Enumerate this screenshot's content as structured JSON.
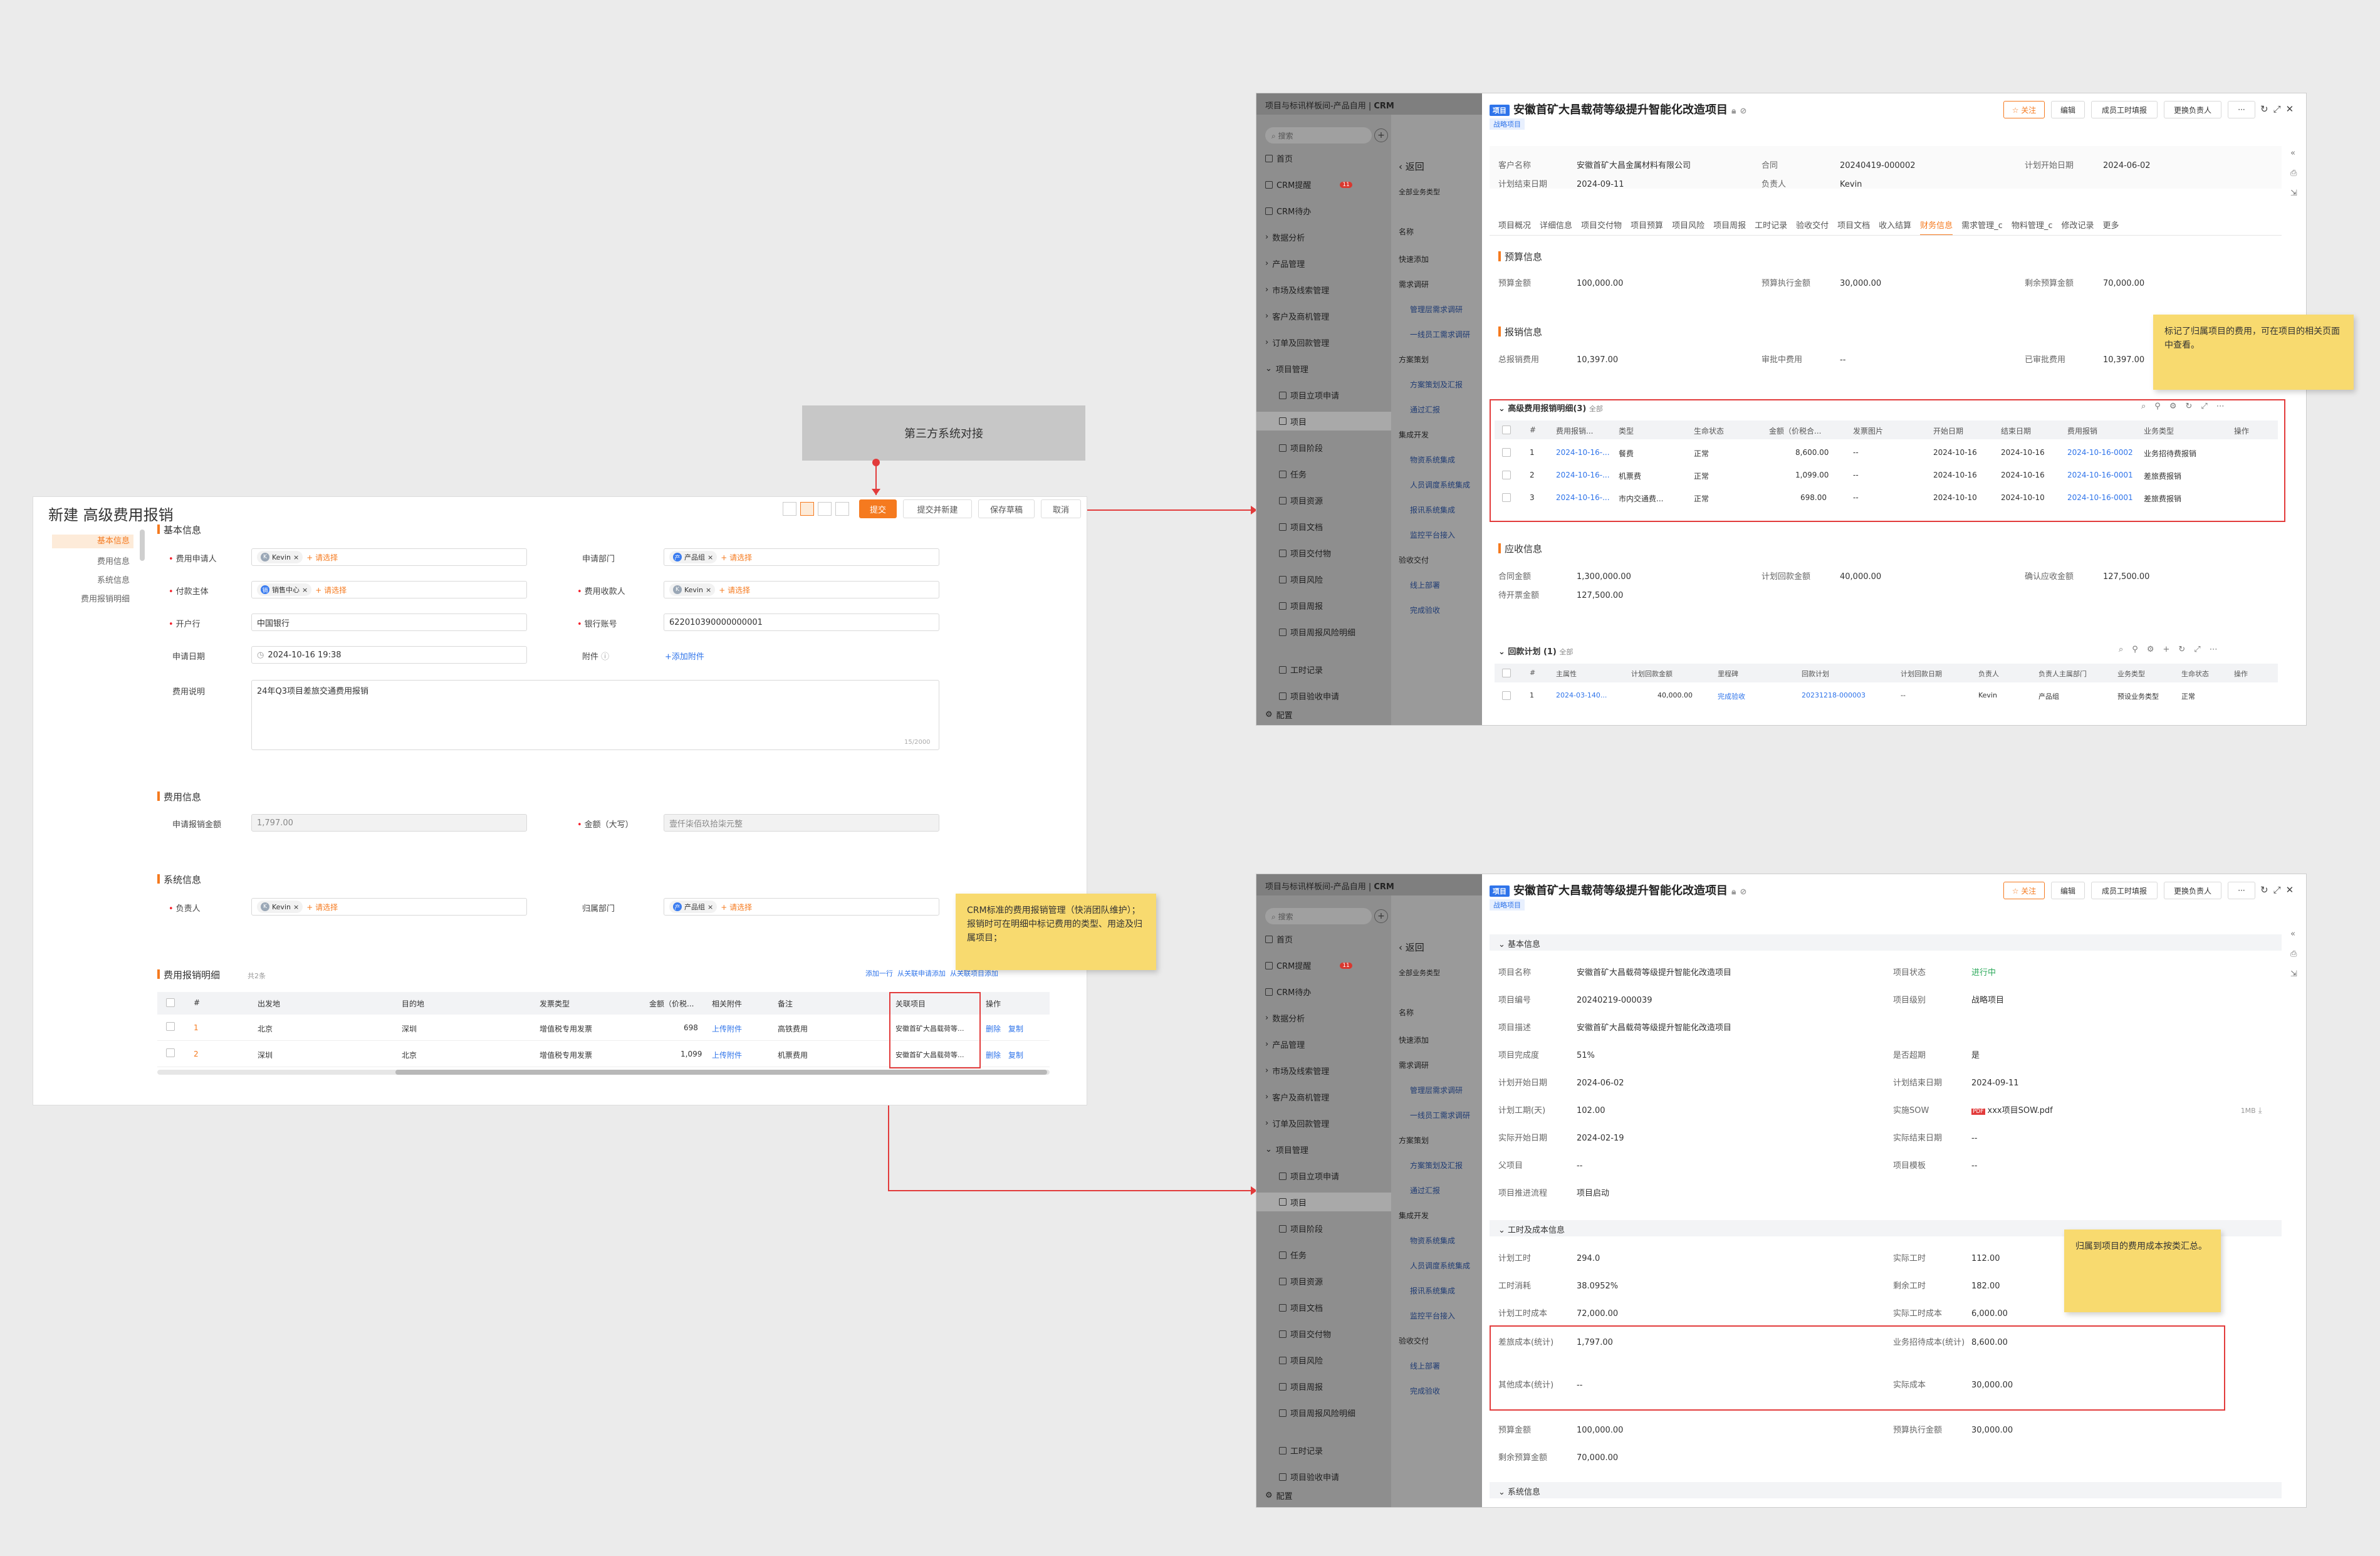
{
  "third_party_box": "第三方系统对接",
  "notes": {
    "crm_note": "CRM标准的费用报销管理（快消团队维护）；\n报销时可在明细中标记费用的类型、用途及归属项目；",
    "finance_note": "标记了归属项目的费用，可在项目的相关页面中查看。",
    "cost_note": "归属到项目的费用成本按类汇总。"
  },
  "form": {
    "title": "新建 高级费用报销",
    "buttons": {
      "submit": "提交",
      "submit_new": "提交并新建",
      "save_draft": "保存草稿",
      "cancel": "取消"
    },
    "left_nav": [
      "基本信息",
      "费用信息",
      "系统信息",
      "费用报销明细"
    ],
    "basic_section": "基本信息",
    "fields": {
      "applicant_label": "费用申请人",
      "applicant_tag": "Kevin",
      "select_placeholder": "+ 请选择",
      "dept_label": "申请部门",
      "dept_tag": "产品组",
      "payer_label": "付款主体",
      "payer_tag": "销售中心",
      "payee_label": "费用收款人",
      "payee_tag": "Kevin",
      "bank_label": "开户行",
      "bank_value": "中国银行",
      "account_label": "银行账号",
      "account_value": "622010390000000001",
      "date_label": "申请日期",
      "date_value": "2024-10-16 19:38",
      "attach_label": "附件",
      "attach_add": "+添加附件",
      "desc_label": "费用说明",
      "desc_value": "24年Q3项目差旅交通费用报销",
      "desc_count": "15/2000"
    },
    "expense_section": "费用信息",
    "expense": {
      "amount_label": "申请报销金额",
      "amount_value": "1,797.00",
      "upper_label": "金额（大写）",
      "upper_value": "壹仟柒佰玖拾柒元整"
    },
    "system_section": "系统信息",
    "system": {
      "owner_label": "负责人",
      "owner_tag": "Kevin",
      "dept_label": "归属部门",
      "dept_tag": "产品组"
    },
    "detail_section": "费用报销明细",
    "detail_count": "共2条",
    "detail_actions": [
      "添加一行",
      "从关联申请添加",
      "从关联项目添加"
    ],
    "detail_headers": [
      "#",
      "出发地",
      "目的地",
      "发票类型",
      "金额（价税...",
      "相关附件",
      "备注",
      "关联项目",
      "操作"
    ],
    "detail_rows": [
      {
        "n": "1",
        "from": "北京",
        "to": "深圳",
        "invoice": "增值税专用发票",
        "amount": "698",
        "attach": "上传附件",
        "remark": "高铁费用",
        "project": "安徽首矿大昌载荷等...",
        "ops": [
          "删除",
          "复制"
        ]
      },
      {
        "n": "2",
        "from": "深圳",
        "to": "北京",
        "invoice": "增值税专用发票",
        "amount": "1,099",
        "attach": "上传附件",
        "remark": "机票费用",
        "project": "安徽首矿大昌载荷等...",
        "ops": [
          "删除",
          "复制"
        ]
      }
    ]
  },
  "crm": {
    "breadcrumb": "项目与标讯样板间-产品自用",
    "app": "CRM",
    "search_placeholder": "搜索",
    "menu": [
      {
        "label": "首页",
        "level": 0
      },
      {
        "label": "CRM提醒",
        "level": 0,
        "badge": "11"
      },
      {
        "label": "CRM待办",
        "level": 0
      },
      {
        "label": "数据分析",
        "level": 0
      },
      {
        "label": "产品管理",
        "level": 0
      },
      {
        "label": "市场及线索管理",
        "level": 0
      },
      {
        "label": "客户及商机管理",
        "level": 0
      },
      {
        "label": "订单及回款管理",
        "level": 0
      },
      {
        "label": "项目管理",
        "level": 0
      },
      {
        "label": "项目立项申请",
        "level": 1
      },
      {
        "label": "项目",
        "level": 1,
        "active": true
      },
      {
        "label": "项目阶段",
        "level": 1
      },
      {
        "label": "任务",
        "level": 1
      },
      {
        "label": "项目资源",
        "level": 1
      },
      {
        "label": "项目文档",
        "level": 1
      },
      {
        "label": "项目交付物",
        "level": 1
      },
      {
        "label": "项目风险",
        "level": 1
      },
      {
        "label": "项目周报",
        "level": 1
      },
      {
        "label": "项目周报风险明细",
        "level": 1
      },
      {
        "label": "工时记录",
        "level": 1
      },
      {
        "label": "项目验收申请",
        "level": 1
      }
    ],
    "config": "配置",
    "list": {
      "back": "返回",
      "filter": "全部业务类型",
      "col": "名称",
      "items": [
        {
          "label": "快速添加",
          "h": true
        },
        {
          "label": "需求调研",
          "h": true
        },
        {
          "label": "管理层需求调研"
        },
        {
          "label": "一线员工需求调研"
        },
        {
          "label": "方案策划",
          "h": true
        },
        {
          "label": "方案策划及汇报"
        },
        {
          "label": "通过汇报"
        },
        {
          "label": "集成开发",
          "h": true
        },
        {
          "label": "物资系统集成"
        },
        {
          "label": "人员调度系统集成"
        },
        {
          "label": "报讯系统集成"
        },
        {
          "label": "监控平台接入"
        },
        {
          "label": "验收交付",
          "h": true
        },
        {
          "label": "线上部署"
        },
        {
          "label": "完成验收"
        }
      ]
    },
    "project_tag": "项目",
    "project_title": "安徽首矿大昌载荷等级提升智能化改造项目",
    "strategic": "战略项目",
    "header_buttons": {
      "follow": "☆ 关注",
      "edit": "编辑",
      "fill_hours": "成员工时填报",
      "change_owner": "更换负责人",
      "more": "···"
    }
  },
  "finance_view": {
    "summary": [
      {
        "k": "客户名称",
        "v": "安徽首矿大昌金属材料有限公司",
        "link": true
      },
      {
        "k": "合同",
        "v": "20240419-000002",
        "link": true
      },
      {
        "k": "计划开始日期",
        "v": "2024-06-02"
      },
      {
        "k": "计划结束日期",
        "v": "2024-09-11"
      },
      {
        "k": "负责人",
        "v": "Kevin"
      }
    ],
    "tabs": [
      "项目概况",
      "详细信息",
      "项目交付物",
      "项目预算",
      "项目风险",
      "项目周报",
      "工时记录",
      "验收交付",
      "项目文档",
      "收入结算",
      "财务信息",
      "需求管理_c",
      "物料管理_c",
      "修改记录",
      "更多"
    ],
    "active_tab": "财务信息",
    "budget_section": "预算信息",
    "budget": [
      {
        "k": "预算金额",
        "v": "100,000.00"
      },
      {
        "k": "预算执行金额",
        "v": "30,000.00"
      },
      {
        "k": "剩余预算金额",
        "v": "70,000.00"
      }
    ],
    "reimburse_section": "报销信息",
    "reimburse": [
      {
        "k": "总报销费用",
        "v": "10,397.00"
      },
      {
        "k": "审批中费用",
        "v": "--"
      },
      {
        "k": "已审批费用",
        "v": "10,397.00"
      }
    ],
    "exp_table_title": "高级费用报销明细(3)",
    "exp_table_filter": "全部",
    "exp_headers": [
      "#",
      "费用报销...",
      "类型",
      "生命状态",
      "金额（价税合...",
      "发票图片",
      "开始日期",
      "结束日期",
      "费用报销",
      "业务类型",
      "操作"
    ],
    "exp_rows": [
      {
        "n": "1",
        "code": "2024-10-16-...",
        "type": "餐费",
        "status": "正常",
        "amount": "8,600.00",
        "img": "--",
        "start": "2024-10-16",
        "end": "2024-10-16",
        "reim": "2024-10-16-0002",
        "biz": "业务招待费报销"
      },
      {
        "n": "2",
        "code": "2024-10-16-...",
        "type": "机票费",
        "status": "正常",
        "amount": "1,099.00",
        "img": "--",
        "start": "2024-10-16",
        "end": "2024-10-16",
        "reim": "2024-10-16-0001",
        "biz": "差旅费报销"
      },
      {
        "n": "3",
        "code": "2024-10-16-...",
        "type": "市内交通费...",
        "status": "正常",
        "amount": "698.00",
        "img": "--",
        "start": "2024-10-10",
        "end": "2024-10-10",
        "reim": "2024-10-16-0001",
        "biz": "差旅费报销"
      }
    ],
    "receivable_section": "应收信息",
    "receivable": [
      {
        "k": "合同金额",
        "v": "1,300,000.00"
      },
      {
        "k": "计划回款金额",
        "v": "40,000.00"
      },
      {
        "k": "确认应收金额",
        "v": "127,500.00"
      },
      {
        "k": "待开票金额",
        "v": "127,500.00"
      }
    ],
    "plan_table_title": "回款计划 (1)",
    "plan_filter": "全部",
    "plan_headers": [
      "#",
      "主属性",
      "计划回款金额",
      "里程碑",
      "回款计划",
      "计划回款日期",
      "负责人",
      "负责人主属部门",
      "业务类型",
      "生命状态",
      "操作"
    ],
    "plan_rows": [
      {
        "n": "1",
        "attr": "2024-03-140...",
        "amount": "40,000.00",
        "milestone": "完成验收",
        "plan": "20231218-000003",
        "date": "--",
        "owner": "Kevin",
        "dept": "产品组",
        "biz": "预设业务类型",
        "status": "正常"
      }
    ]
  },
  "detail_view": {
    "basic_section": "基本信息",
    "basic": [
      {
        "k": "项目名称",
        "v": "安徽首矿大昌载荷等级提升智能化改造项目"
      },
      {
        "k": "项目状态",
        "v": "进行中",
        "green": true
      },
      {
        "k": "项目编号",
        "v": "20240219-000039"
      },
      {
        "k": "项目级别",
        "v": "战略项目"
      },
      {
        "k": "项目描述",
        "v": "安徽首矿大昌载荷等级提升智能化改造项目"
      },
      {
        "k": "项目完成度",
        "v": "51%"
      },
      {
        "k": "是否超期",
        "v": "是"
      },
      {
        "k": "计划开始日期",
        "v": "2024-06-02"
      },
      {
        "k": "计划结束日期",
        "v": "2024-09-11"
      },
      {
        "k": "计划工期(天)",
        "v": "102.00"
      },
      {
        "k": "实施SOW",
        "v": "xxx项目SOW.pdf",
        "link": true,
        "size": "1MB"
      },
      {
        "k": "实际开始日期",
        "v": "2024-02-19"
      },
      {
        "k": "实际结束日期",
        "v": "--"
      },
      {
        "k": "父项目",
        "v": "--"
      },
      {
        "k": "项目模板",
        "v": "--"
      },
      {
        "k": "项目推进流程",
        "v": "项目启动"
      }
    ],
    "cost_section": "工时及成本信息",
    "cost": [
      {
        "k": "计划工时",
        "v": "294.0"
      },
      {
        "k": "实际工时",
        "v": "112.00"
      },
      {
        "k": "工时消耗",
        "v": "38.0952%"
      },
      {
        "k": "剩余工时",
        "v": "182.00"
      },
      {
        "k": "计划工时成本",
        "v": "72,000.00"
      },
      {
        "k": "实际工时成本",
        "v": "6,000.00"
      },
      {
        "k": "差旅成本(统计)",
        "v": "1,797.00"
      },
      {
        "k": "业务招待成本(统计)",
        "v": "8,600.00"
      },
      {
        "k": "其他成本(统计)",
        "v": "--"
      },
      {
        "k": "实际成本",
        "v": "30,000.00"
      },
      {
        "k": "预算金额",
        "v": "100,000.00"
      },
      {
        "k": "预算执行金额",
        "v": "30,000.00"
      },
      {
        "k": "剩余预算金额",
        "v": "70,000.00"
      }
    ],
    "system_section": "系统信息"
  }
}
